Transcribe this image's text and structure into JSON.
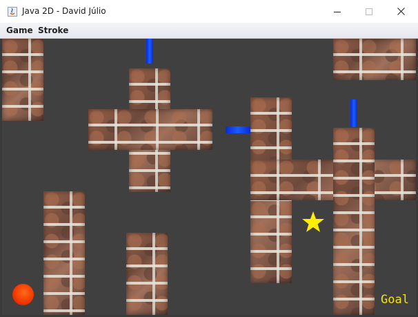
{
  "window": {
    "title": "Java 2D - David Júlio",
    "controls": {
      "minimize": "minimize-icon",
      "maximize": "maximize-icon",
      "close": "close-icon"
    }
  },
  "menu": {
    "items": [
      {
        "label": "Game"
      },
      {
        "label": "Stroke"
      }
    ]
  },
  "game": {
    "background_color": "#404040",
    "player": {
      "shape": "circle",
      "color": "#f23a00"
    },
    "target": {
      "shape": "star",
      "color": "#ffee00"
    },
    "goal_label": "Goal",
    "goal_color": "#f4e20a",
    "block_color": "#1a5cff",
    "wall_texture": "brick"
  }
}
